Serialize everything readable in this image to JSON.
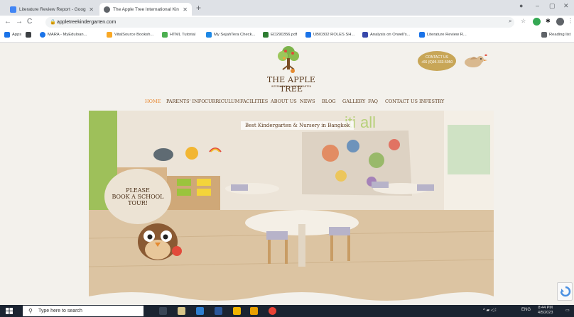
{
  "browser": {
    "tabs": [
      {
        "title": "Literature Review Report - Googl",
        "active": false,
        "favicon_color": "#4285f4"
      },
      {
        "title": "The Apple Tree International Kin",
        "active": true,
        "favicon_color": "#5f6368"
      }
    ],
    "new_tab": "+",
    "window_controls": {
      "minimize": "–",
      "maximize": "▢",
      "close": "✕"
    },
    "address": "appletreekindergarten.com",
    "bookmarks": [
      {
        "label": "Apps",
        "color": "#1a73e8"
      },
      {
        "label": "",
        "color": "#3c4043"
      },
      {
        "label": "MARA - MyEduloan...",
        "color": "#1a73e8"
      },
      {
        "label": "VitalSource Booksh...",
        "color": "#f9a825"
      },
      {
        "label": "HTML Tutorial",
        "color": "#4caf50"
      },
      {
        "label": "My SejahTera Check...",
        "color": "#1e88e5"
      },
      {
        "label": "ED290356.pdf",
        "color": "#2e7d32"
      },
      {
        "label": "UBI0302 ROLES SH...",
        "color": "#1a73e8"
      },
      {
        "label": "Analysis on Orwell's...",
        "color": "#3949ab"
      },
      {
        "label": "Literature Review R...",
        "color": "#1a73e8"
      },
      {
        "label": "Reading list",
        "color": "#5f6368"
      }
    ]
  },
  "site": {
    "logo_title": "THE APPLE TREE",
    "logo_subtitle": "INTERNATIONAL KINDERGARTEN",
    "contact_label": "CONTACT US",
    "contact_phone": "+66 (0)95-333-5950",
    "nav": [
      "HOME",
      "PARENTS' INFO",
      "CURRICULUM",
      "FACILITIES",
      "ABOUT US",
      "NEWS",
      "BLOG",
      "GALLERY",
      "FAQ",
      "CONTACT US",
      "INFESTRY"
    ],
    "hero_banner": "Best Kindergarten & Nursery in Bangkok",
    "tour_line1": "PLEASE",
    "tour_line2": "BOOK A SCHOOL TOUR!",
    "wall_letters": "iti all"
  },
  "taskbar": {
    "search_placeholder": "Type here to search",
    "tray_lang": "ENG",
    "time": "8:44 PM",
    "date": "4/5/2023"
  },
  "colors": {
    "brand_brown": "#5a3a1e",
    "nav_active": "#e8862e",
    "contact_badge": "#c8a657",
    "page_bg": "#f3f1ec"
  }
}
